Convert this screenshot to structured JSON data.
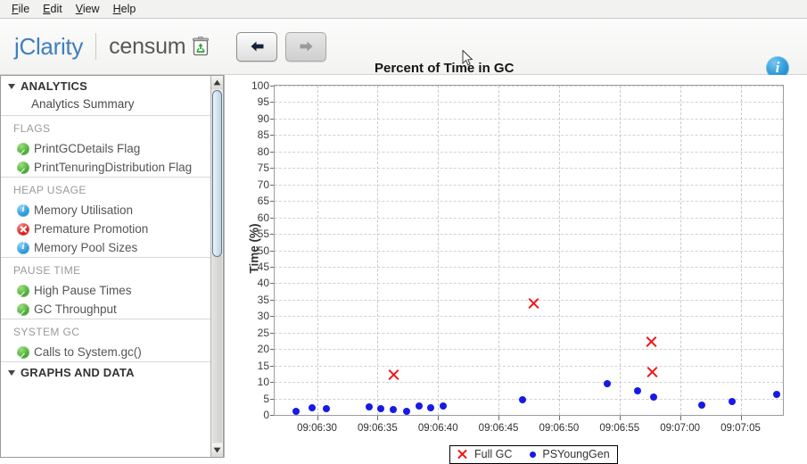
{
  "menubar": {
    "items": [
      {
        "mnemonic": "F",
        "rest": "ile"
      },
      {
        "mnemonic": "E",
        "rest": "dit"
      },
      {
        "mnemonic": "V",
        "rest": "iew"
      },
      {
        "mnemonic": "H",
        "rest": "elp"
      }
    ]
  },
  "header": {
    "brand_primary": "jClarity",
    "brand_secondary": "censum",
    "brand_icon": "recycle-icon",
    "back_label": "←",
    "forward_label": "→",
    "title": "Percent of Time in GC",
    "info_label": "i"
  },
  "sidebar": {
    "sections": [
      {
        "type": "section-header",
        "label": "ANALYTICS",
        "expanded": true
      },
      {
        "type": "sub-item",
        "label": "Analytics Summary"
      },
      {
        "type": "divider"
      },
      {
        "type": "group-label",
        "label": "FLAGS"
      },
      {
        "type": "row",
        "status": "ok",
        "label": "PrintGCDetails Flag"
      },
      {
        "type": "row",
        "status": "ok",
        "label": "PrintTenuringDistribution Flag"
      },
      {
        "type": "divider"
      },
      {
        "type": "group-label",
        "label": "HEAP USAGE"
      },
      {
        "type": "row",
        "status": "info",
        "label": "Memory Utilisation"
      },
      {
        "type": "row",
        "status": "error",
        "label": "Premature Promotion"
      },
      {
        "type": "row",
        "status": "info",
        "label": "Memory Pool Sizes"
      },
      {
        "type": "divider"
      },
      {
        "type": "group-label",
        "label": "PAUSE TIME"
      },
      {
        "type": "row",
        "status": "ok",
        "label": "High Pause Times"
      },
      {
        "type": "row",
        "status": "ok",
        "label": "GC Throughput"
      },
      {
        "type": "divider"
      },
      {
        "type": "group-label",
        "label": "SYSTEM GC"
      },
      {
        "type": "row",
        "status": "ok",
        "label": "Calls to System.gc()"
      },
      {
        "type": "divider"
      },
      {
        "type": "section-header",
        "label": "GRAPHS AND DATA",
        "expanded": true
      }
    ],
    "scrollbar": {
      "up_arrow": "▲",
      "down_arrow": "▼"
    }
  },
  "chart_data": {
    "type": "scatter",
    "title": "Percent of Time in GC",
    "xlabel": "",
    "ylabel": "Time (%)",
    "ylim": [
      0,
      100
    ],
    "ytick_step": 5,
    "yticks": [
      0,
      5,
      10,
      15,
      20,
      25,
      30,
      35,
      40,
      45,
      50,
      55,
      60,
      65,
      70,
      75,
      80,
      85,
      90,
      95,
      100
    ],
    "xticks": [
      "09:06:30",
      "09:06:35",
      "09:06:40",
      "09:06:45",
      "09:06:50",
      "09:06:55",
      "09:07:00",
      "09:07:05"
    ],
    "xlim_seconds": [
      26.5,
      68.5
    ],
    "xtick_seconds": [
      30,
      35,
      40,
      45,
      50,
      55,
      60,
      65
    ],
    "grid": true,
    "legend_position": "bottom-center",
    "series": [
      {
        "name": "Full GC",
        "marker": "x",
        "color": "#f01515",
        "points": [
          {
            "t": 36.3,
            "x_label": "09:06:36",
            "y": 12.2
          },
          {
            "t": 47.9,
            "x_label": "09:06:48",
            "y": 33.9
          },
          {
            "t": 57.6,
            "x_label": "09:06:58",
            "y": 22.2
          },
          {
            "t": 57.7,
            "x_label": "09:06:58",
            "y": 13.0
          }
        ]
      },
      {
        "name": "PSYoungGen",
        "marker": "o",
        "color": "#1919e6",
        "points": [
          {
            "t": 28.3,
            "x_label": "09:06:28",
            "y": 1.0
          },
          {
            "t": 29.6,
            "x_label": "09:06:30",
            "y": 2.3
          },
          {
            "t": 30.8,
            "x_label": "09:06:31",
            "y": 1.9
          },
          {
            "t": 34.3,
            "x_label": "09:06:34",
            "y": 2.4
          },
          {
            "t": 35.3,
            "x_label": "09:06:35",
            "y": 2.0
          },
          {
            "t": 36.3,
            "x_label": "09:06:36",
            "y": 1.7
          },
          {
            "t": 37.4,
            "x_label": "09:06:37",
            "y": 1.1
          },
          {
            "t": 38.4,
            "x_label": "09:06:38",
            "y": 2.6
          },
          {
            "t": 39.4,
            "x_label": "09:06:39",
            "y": 2.3
          },
          {
            "t": 40.4,
            "x_label": "09:06:40",
            "y": 2.8
          },
          {
            "t": 47.0,
            "x_label": "09:06:47",
            "y": 4.6
          },
          {
            "t": 54.0,
            "x_label": "09:06:54",
            "y": 9.4
          },
          {
            "t": 56.5,
            "x_label": "09:06:56",
            "y": 7.4
          },
          {
            "t": 57.8,
            "x_label": "09:06:58",
            "y": 5.5
          },
          {
            "t": 61.8,
            "x_label": "09:07:02",
            "y": 2.9
          },
          {
            "t": 64.3,
            "x_label": "09:07:04",
            "y": 4.0
          },
          {
            "t": 68.0,
            "x_label": "09:07:08",
            "y": 6.1
          }
        ]
      }
    ]
  }
}
